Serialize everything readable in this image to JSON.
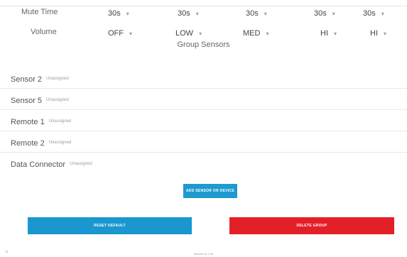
{
  "settings": {
    "mute_time": {
      "label": "Mute Time",
      "options": [
        "30s",
        "30s",
        "30s",
        "30s",
        "30s"
      ]
    },
    "volume": {
      "label": "Volume",
      "options": [
        "OFF",
        "LOW",
        "MED",
        "HI",
        "HI"
      ]
    }
  },
  "group_sensors": {
    "title": "Group Sensors",
    "items": [
      {
        "name": "Sensor 2",
        "status": "Unassigned"
      },
      {
        "name": "Sensor 5",
        "status": "Unassigned"
      },
      {
        "name": "Remote 1",
        "status": "Unassigned"
      },
      {
        "name": "Remote 2",
        "status": "Unassigned"
      },
      {
        "name": "Data Connector",
        "status": "Unassigned"
      }
    ]
  },
  "actions": {
    "add_label": "Add Sensor or Device",
    "reset_label": "Reset Default",
    "delete_label": "Delete Group"
  },
  "footer": {
    "version": "Version v2.3.15"
  },
  "colors": {
    "primary": "#1a97cf",
    "danger": "#e32027"
  }
}
